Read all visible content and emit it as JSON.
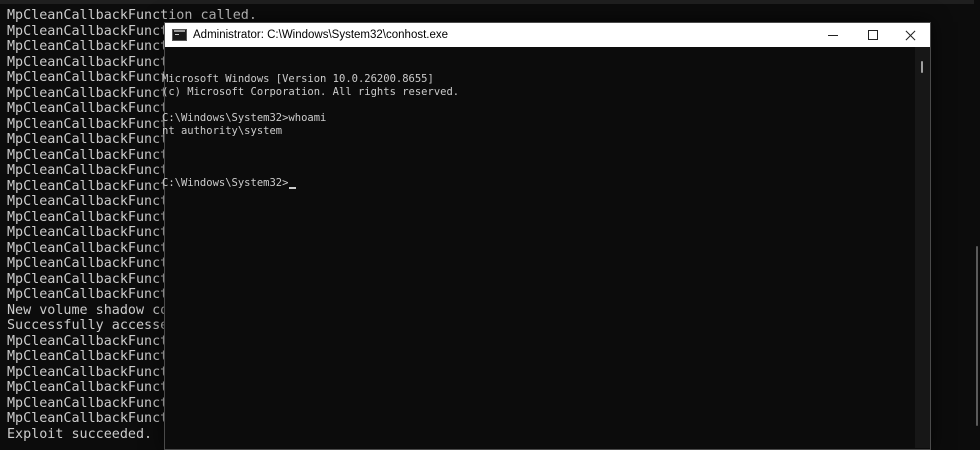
{
  "background_terminal": {
    "lines": [
      "MpCleanCallbackFunction called.",
      "MpCleanCallbackFunct",
      "MpCleanCallbackFunct",
      "MpCleanCallbackFunct",
      "MpCleanCallbackFunct",
      "MpCleanCallbackFunct",
      "MpCleanCallbackFunct",
      "MpCleanCallbackFunct",
      "MpCleanCallbackFunct",
      "MpCleanCallbackFunct",
      "MpCleanCallbackFunct",
      "MpCleanCallbackFunct",
      "MpCleanCallbackFunct",
      "MpCleanCallbackFunct",
      "MpCleanCallbackFunct",
      "MpCleanCallbackFunct",
      "MpCleanCallbackFunct",
      "MpCleanCallbackFunct",
      "MpCleanCallbackFunct",
      "New volume shadow co",
      "Successfully accesse",
      "MpCleanCallbackFunct",
      "MpCleanCallbackFunct",
      "MpCleanCallbackFunct",
      "MpCleanCallbackFunct",
      "MpCleanCallbackFunct",
      "MpCleanCallbackFunct",
      "Exploit succeeded."
    ]
  },
  "window": {
    "title": "Administrator: C:\\Windows\\System32\\conhost.exe",
    "icon": "console-app-icon",
    "buttons": {
      "minimize": "minimize-icon",
      "maximize": "maximize-icon",
      "close": "close-icon"
    },
    "console_lines": [
      "Microsoft Windows [Version 10.0.26200.8655]",
      "(c) Microsoft Corporation. All rights reserved.",
      "",
      "C:\\Windows\\System32>whoami",
      "nt authority\\system",
      ""
    ],
    "prompt": "C:\\Windows\\System32>"
  },
  "colors": {
    "console_bg": "#0c0c0c",
    "console_text": "#cccccc",
    "titlebar_bg": "#ffffff"
  }
}
